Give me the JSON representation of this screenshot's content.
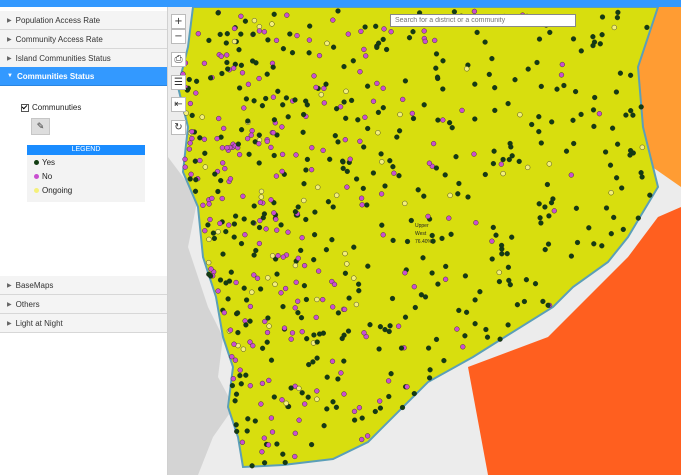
{
  "colors": {
    "accent": "#3399ff",
    "legend_header": "#1a8cff",
    "region_fill": "#d8de0e",
    "neighbor_fill": "#ff5f1f",
    "neighbor_fill_light": "#ff9c33",
    "boundary": "#5b9fb8",
    "yes": "#123d12",
    "no": "#c94fd0",
    "ongoing": "#f4f07a"
  },
  "sidebar": {
    "top_items": [
      {
        "label": "Population Access Rate"
      },
      {
        "label": "Community Access Rate"
      },
      {
        "label": "Island Communities Status"
      },
      {
        "label": "Communities Status"
      }
    ],
    "active_panel": {
      "layer_label": "Communuties",
      "layer_checked": true,
      "legend": {
        "title": "LEGEND",
        "items": [
          {
            "label": "Yes",
            "color": "#123d12"
          },
          {
            "label": "No",
            "color": "#c94fd0"
          },
          {
            "label": "Ongoing",
            "color": "#f4f07a"
          }
        ]
      }
    },
    "bottom_items": [
      {
        "label": "BaseMaps"
      },
      {
        "label": "Others"
      },
      {
        "label": "Light at Night"
      }
    ]
  },
  "map": {
    "search_placeholder": "Search for a district or a community",
    "region": {
      "name_line1": "Upper",
      "name_line2": "West",
      "rate": "76.40%"
    },
    "controls": [
      {
        "name": "zoom-in-button",
        "glyph": "+"
      },
      {
        "name": "zoom-out-button",
        "glyph": "−"
      },
      {
        "name": "print-button",
        "glyph": "⎙"
      },
      {
        "name": "filter-button",
        "glyph": "☰"
      },
      {
        "name": "collapse-panel-button",
        "glyph": "⇤"
      },
      {
        "name": "refresh-button",
        "glyph": "↻"
      }
    ]
  }
}
